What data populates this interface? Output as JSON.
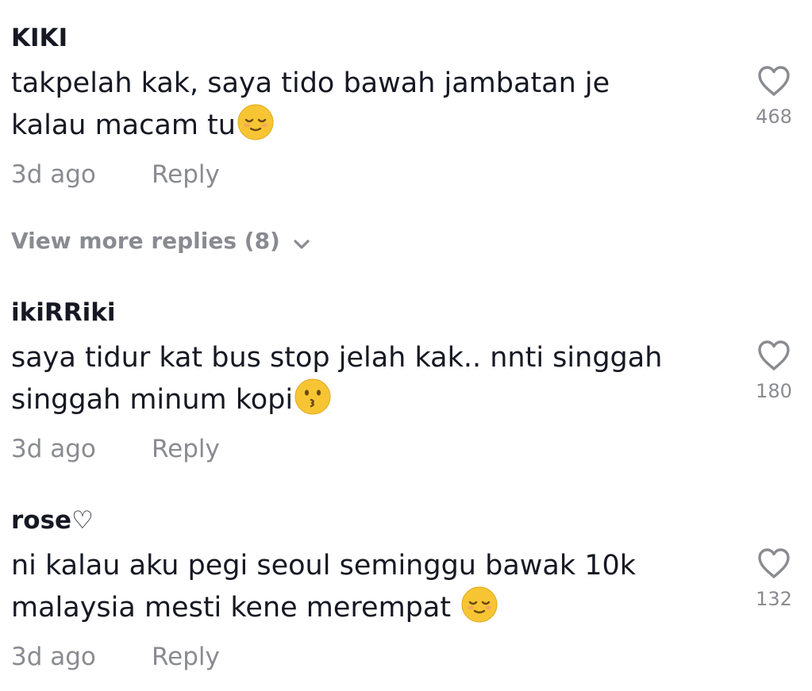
{
  "comments": [
    {
      "username": "KIKI",
      "line1": "takpelah kak, saya tido bawah jambatan je",
      "line2": "kalau macam tu",
      "emoji": "relieved-face-emoji",
      "likes": "468",
      "time": "3d ago",
      "reply_label": "Reply"
    },
    {
      "username": "ikiRRiki",
      "line1": "saya tidur kat bus stop jelah kak.. nnti singgah",
      "line2": "singgah minum kopi",
      "emoji": "kissing-face-emoji",
      "likes": "180",
      "time": "3d ago",
      "reply_label": "Reply"
    },
    {
      "username": "rose♡",
      "line1": "ni kalau aku pegi seoul seminggu bawak 10k",
      "line2": "malaysia mesti kene merempat ",
      "emoji": "relieved-face-emoji",
      "likes": "132",
      "time": "3d ago",
      "reply_label": "Reply"
    }
  ],
  "view_more": {
    "label": "View more replies (8)",
    "icon": "chevron-down-icon"
  },
  "colors": {
    "text": "#161823",
    "muted": "#8a8b91",
    "emoji_face": "#f7c534",
    "background": "#ffffff"
  }
}
